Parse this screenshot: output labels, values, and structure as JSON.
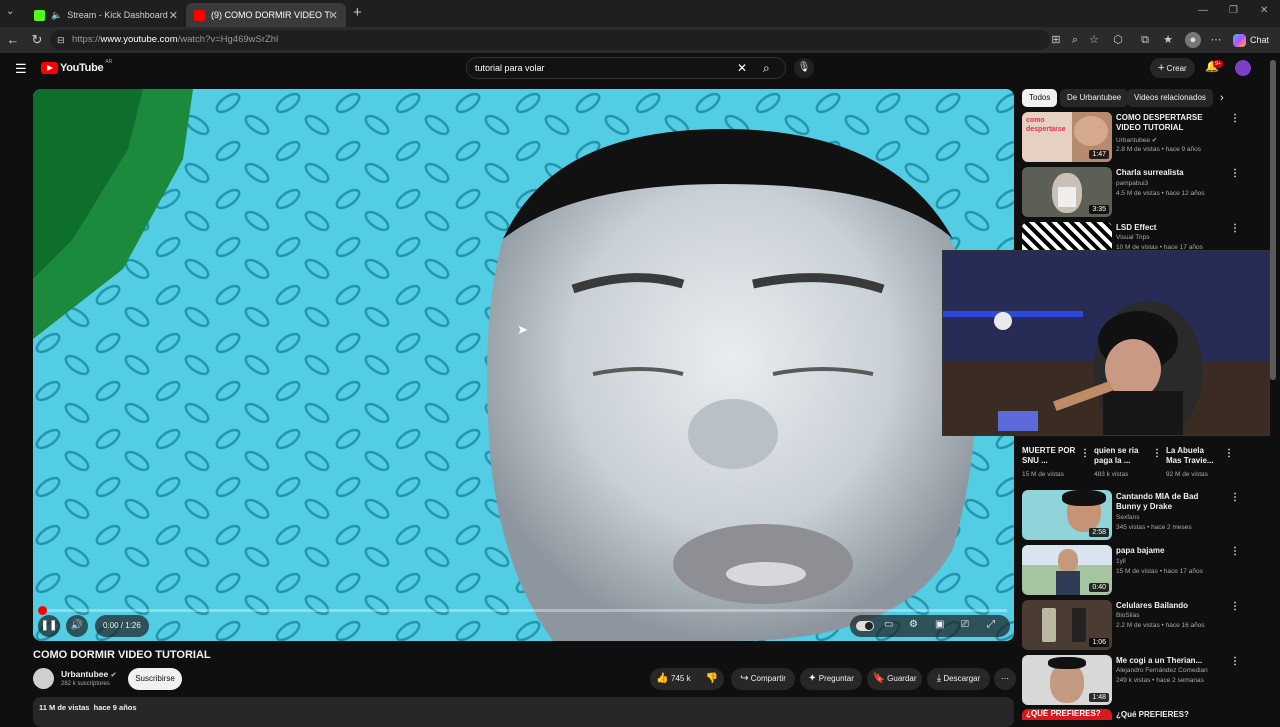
{
  "browser": {
    "tabs": [
      {
        "title": "Stream - Kick Dashboard",
        "active": false
      },
      {
        "title": "(9) COMO DORMIR VIDEO TUTORIAL",
        "active": true
      }
    ],
    "url_prefix": "https://",
    "url_host": "www.youtube.com",
    "url_path": "/watch?v=Hg469wSrZhl",
    "chat_label": "Chat"
  },
  "youtube": {
    "logo": "YouTube",
    "region": "AR",
    "search_query": "tutorial para volar",
    "create_label": "Crear",
    "notification_count": "9+"
  },
  "player": {
    "time": "0:00 / 1:26",
    "progress": 0.0
  },
  "video": {
    "title": "COMO DORMIR VIDEO TUTORIAL",
    "channel": "Urbantubee",
    "subscribers": "282 k suscriptores",
    "subscribe_label": "Suscribirse",
    "likes": "745 k",
    "share_label": "Compartir",
    "ask_label": "Preguntar",
    "save_label": "Guardar",
    "download_label": "Descargar",
    "views": "11 M de vistas",
    "date": "hace 9 años"
  },
  "sidebar": {
    "chips": [
      "Todos",
      "De Urbantubee",
      "Videos relacionados"
    ],
    "videos": [
      {
        "title": "COMO DESPERTARSE VIDEO TUTORIAL",
        "channel": "Urbantubee",
        "meta": "2.8 M de vistas • hace 9 años",
        "duration": "1:47",
        "thumb_text": "como despertarse"
      },
      {
        "title": "Charla surrealista",
        "channel": "pampabui3",
        "meta": "4.5 M de vistas • hace 12 años",
        "duration": "3:35"
      },
      {
        "title": "LSD Effect",
        "channel": "Visual Trips",
        "meta": "10 M de vistas • hace 17 años",
        "duration": ""
      }
    ],
    "shorts": [
      {
        "title": "MUERTE POR SNU ...",
        "views": "15 M de vistas"
      },
      {
        "title": "quien se ria paga la ...",
        "views": "483 k vistas"
      },
      {
        "title": "La Abuela Mas Travie...",
        "views": "92 M de vistas"
      }
    ],
    "videos2": [
      {
        "title": "Cantando MIA de Bad Bunny y Drake",
        "channel": "Sexfans",
        "meta": "345 vistas • hace 2 meses",
        "duration": "2:58"
      },
      {
        "title": "papa bajame",
        "channel": "1yll",
        "meta": "15 M de vistas • hace 17 años",
        "duration": "0:40"
      },
      {
        "title": "Celulares Bailando",
        "channel": "BioSilas",
        "meta": "2.2 M de vistas • hace 16 años",
        "duration": "1:06"
      },
      {
        "title": "Me cogi a un Therian...",
        "channel": "Alejandro Fernández Comedian",
        "meta": "249 k vistas • hace 2 semanas",
        "duration": "1:48"
      },
      {
        "title": "¿Qué PREFIERES?",
        "thumb_text": "¿QUÉ PREFIERES?"
      }
    ]
  }
}
